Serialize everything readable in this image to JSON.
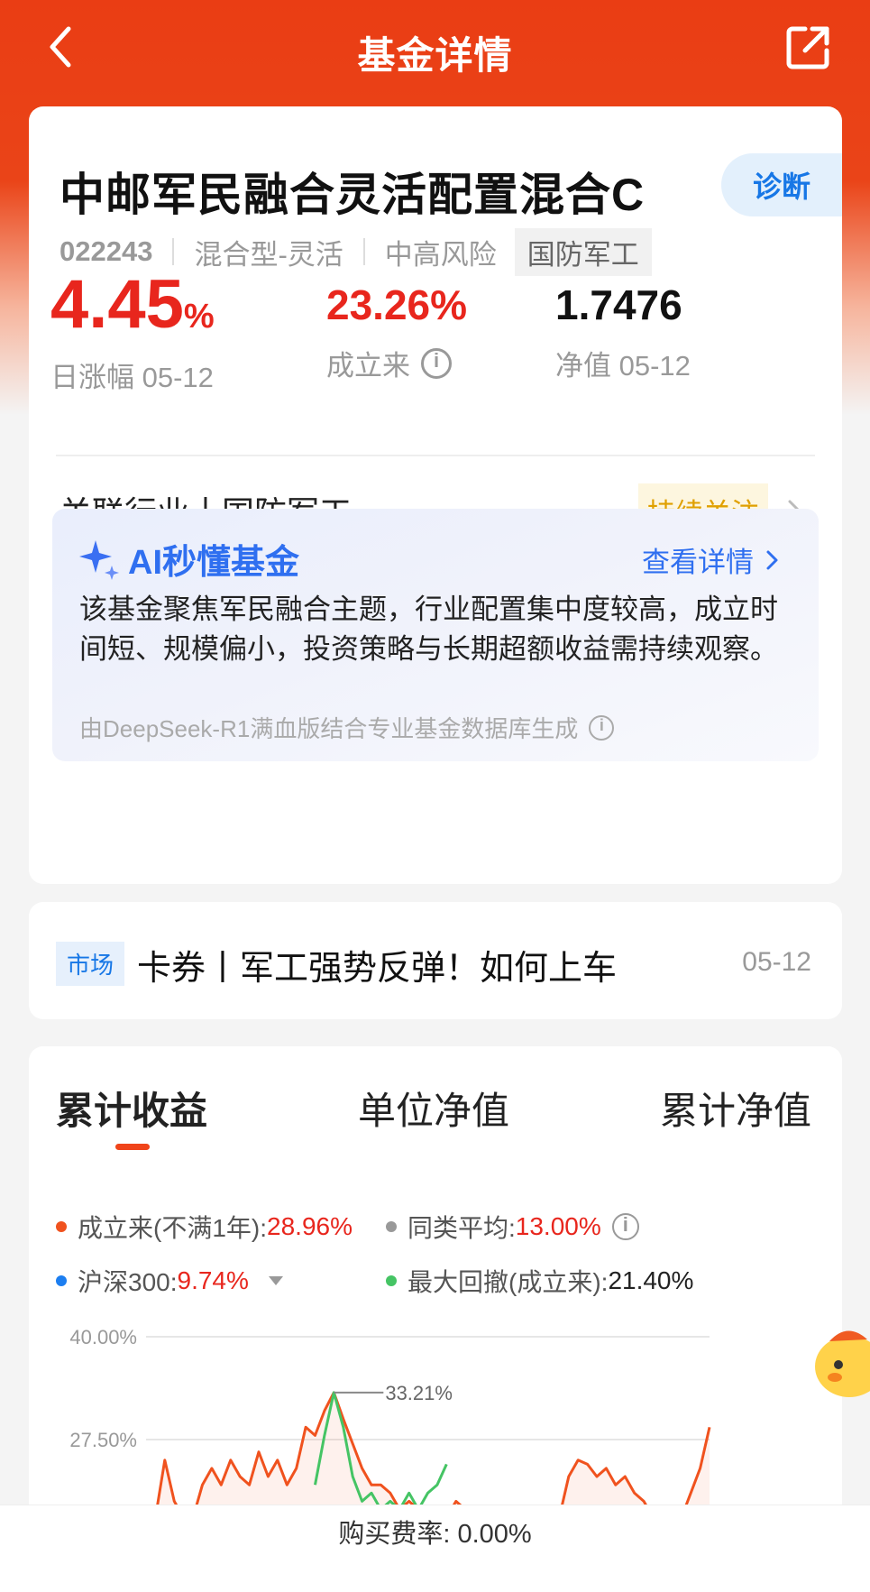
{
  "nav": {
    "title": "基金详情"
  },
  "fund": {
    "name": "中邮军民融合灵活配置混合C",
    "diagnose_label": "诊断",
    "code": "022243",
    "type": "混合型-灵活",
    "risk": "中高风险",
    "theme_tag": "国防军工"
  },
  "stats": {
    "daily_change": "4.45",
    "daily_change_unit": "%",
    "daily_label": "日涨幅 05-12",
    "since_inception": "23.26%",
    "since_inception_label": "成立来",
    "nav_value": "1.7476",
    "nav_label": "净值 05-12"
  },
  "industry": {
    "text": "关联行业丨国防军工",
    "follow_label": "持续关注"
  },
  "ai": {
    "title": "AI秒懂基金",
    "more_label": "查看详情",
    "summary": "该基金聚焦军民融合主题，行业配置集中度较高，成立时间短、规模偏小，投资策略与长期超额收益需持续观察。",
    "source": "由DeepSeek-R1满血版结合专业基金数据库生成"
  },
  "news": {
    "tag": "市场",
    "title": "卡券丨军工强势反弹！如何上车",
    "date": "05-12"
  },
  "tabs": [
    "累计收益",
    "单位净值",
    "累计净值"
  ],
  "legend": {
    "since": {
      "label": "成立来(不满1年):",
      "value": "28.96%",
      "color": "#f0521e"
    },
    "peer": {
      "label": "同类平均:",
      "value": "13.00%",
      "color": "#999999"
    },
    "hs300": {
      "label": "沪深300:",
      "value": "9.74%",
      "color": "#1c7ef0"
    },
    "drawdown": {
      "label": "最大回撤(成立来):",
      "value": "21.40%",
      "color": "#45c464"
    }
  },
  "chart_data": {
    "type": "line",
    "ytick_labels": [
      "40.00%",
      "27.50%"
    ],
    "ylim": [
      15.0,
      40.0
    ],
    "annotation": {
      "label": "33.21%",
      "value": 33.21
    },
    "series": [
      {
        "color": "#f0521e",
        "x": [
          0,
          1,
          2,
          3,
          4,
          5,
          6,
          7,
          8,
          9,
          10,
          11,
          12,
          13,
          14,
          15,
          16,
          17,
          18,
          19,
          20,
          21,
          22,
          23,
          24,
          25,
          26,
          27,
          28,
          29,
          30,
          31,
          32,
          33,
          34,
          35,
          36,
          37,
          38,
          39,
          40,
          41,
          42,
          43,
          44,
          45,
          46,
          47,
          48,
          49,
          50,
          51,
          52,
          53,
          54,
          55,
          56,
          57,
          58,
          59,
          60
        ],
        "y": [
          18,
          18,
          25,
          20,
          18,
          18,
          22,
          24,
          22,
          25,
          23,
          22,
          26,
          23,
          25,
          22,
          24,
          29,
          28,
          31,
          33.21,
          30,
          27,
          24,
          22,
          22,
          21,
          19,
          20,
          19,
          18,
          19,
          18,
          20,
          19,
          18,
          18,
          19,
          18,
          18,
          18,
          18,
          18,
          18,
          18,
          23,
          25,
          24.5,
          23,
          24,
          22,
          23,
          21,
          20,
          18,
          18,
          18,
          18,
          21,
          24,
          29
        ]
      },
      {
        "color": "#45c464",
        "x": [
          18,
          19,
          20,
          21,
          22,
          23,
          24,
          25,
          26,
          27,
          28,
          29,
          30,
          31,
          32
        ],
        "y": [
          22,
          28,
          33.21,
          29,
          23,
          20,
          21,
          19,
          20,
          19,
          21,
          19,
          21,
          22,
          24.5
        ]
      }
    ]
  },
  "footer": {
    "fee": "购买费率: 0.00%"
  }
}
